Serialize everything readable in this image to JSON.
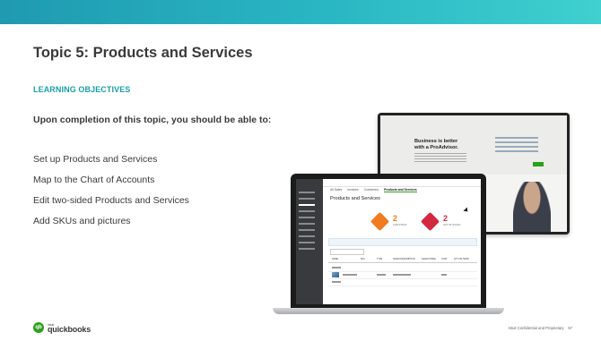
{
  "slide": {
    "title": "Topic 5: Products and Services",
    "section_heading": "LEARNING OBJECTIVES",
    "intro": "Upon completion of this topic, you should be able to:",
    "objectives": [
      "Set up Products and Services",
      "Map to the Chart of Accounts",
      "Edit two-sided Products and Services",
      "Add SKUs and pictures"
    ]
  },
  "footer": {
    "logo_text": "quickbooks",
    "logo_prefix": "intuit",
    "confidential": "Intuit Confidential and Proprietary",
    "page_number": "57"
  },
  "screenshot_monitor": {
    "headline": "Business is better with a ProAdvisor."
  },
  "screenshot_laptop": {
    "tabs": [
      "All Sales",
      "Invoices",
      "Customers",
      "Products and Services"
    ],
    "active_tab": "Products and Services",
    "page_title": "Products and Services",
    "stat_low_stock_value": "2",
    "stat_low_stock_label": "LOW STOCK",
    "stat_out_of_stock_value": "2",
    "stat_out_of_stock_label": "OUT OF STOCK",
    "table_headers": [
      "NAME",
      "SKU",
      "TYPE",
      "SALES DESCRIPTION",
      "SALES PRICE",
      "COST",
      "QTY ON HAND"
    ]
  },
  "colors": {
    "header_band": "#2ab7c4",
    "section_heading": "#1aa0a6",
    "brand_green": "#2ca01c",
    "low_stock": "#f27b1f",
    "out_of_stock": "#d3283f"
  }
}
